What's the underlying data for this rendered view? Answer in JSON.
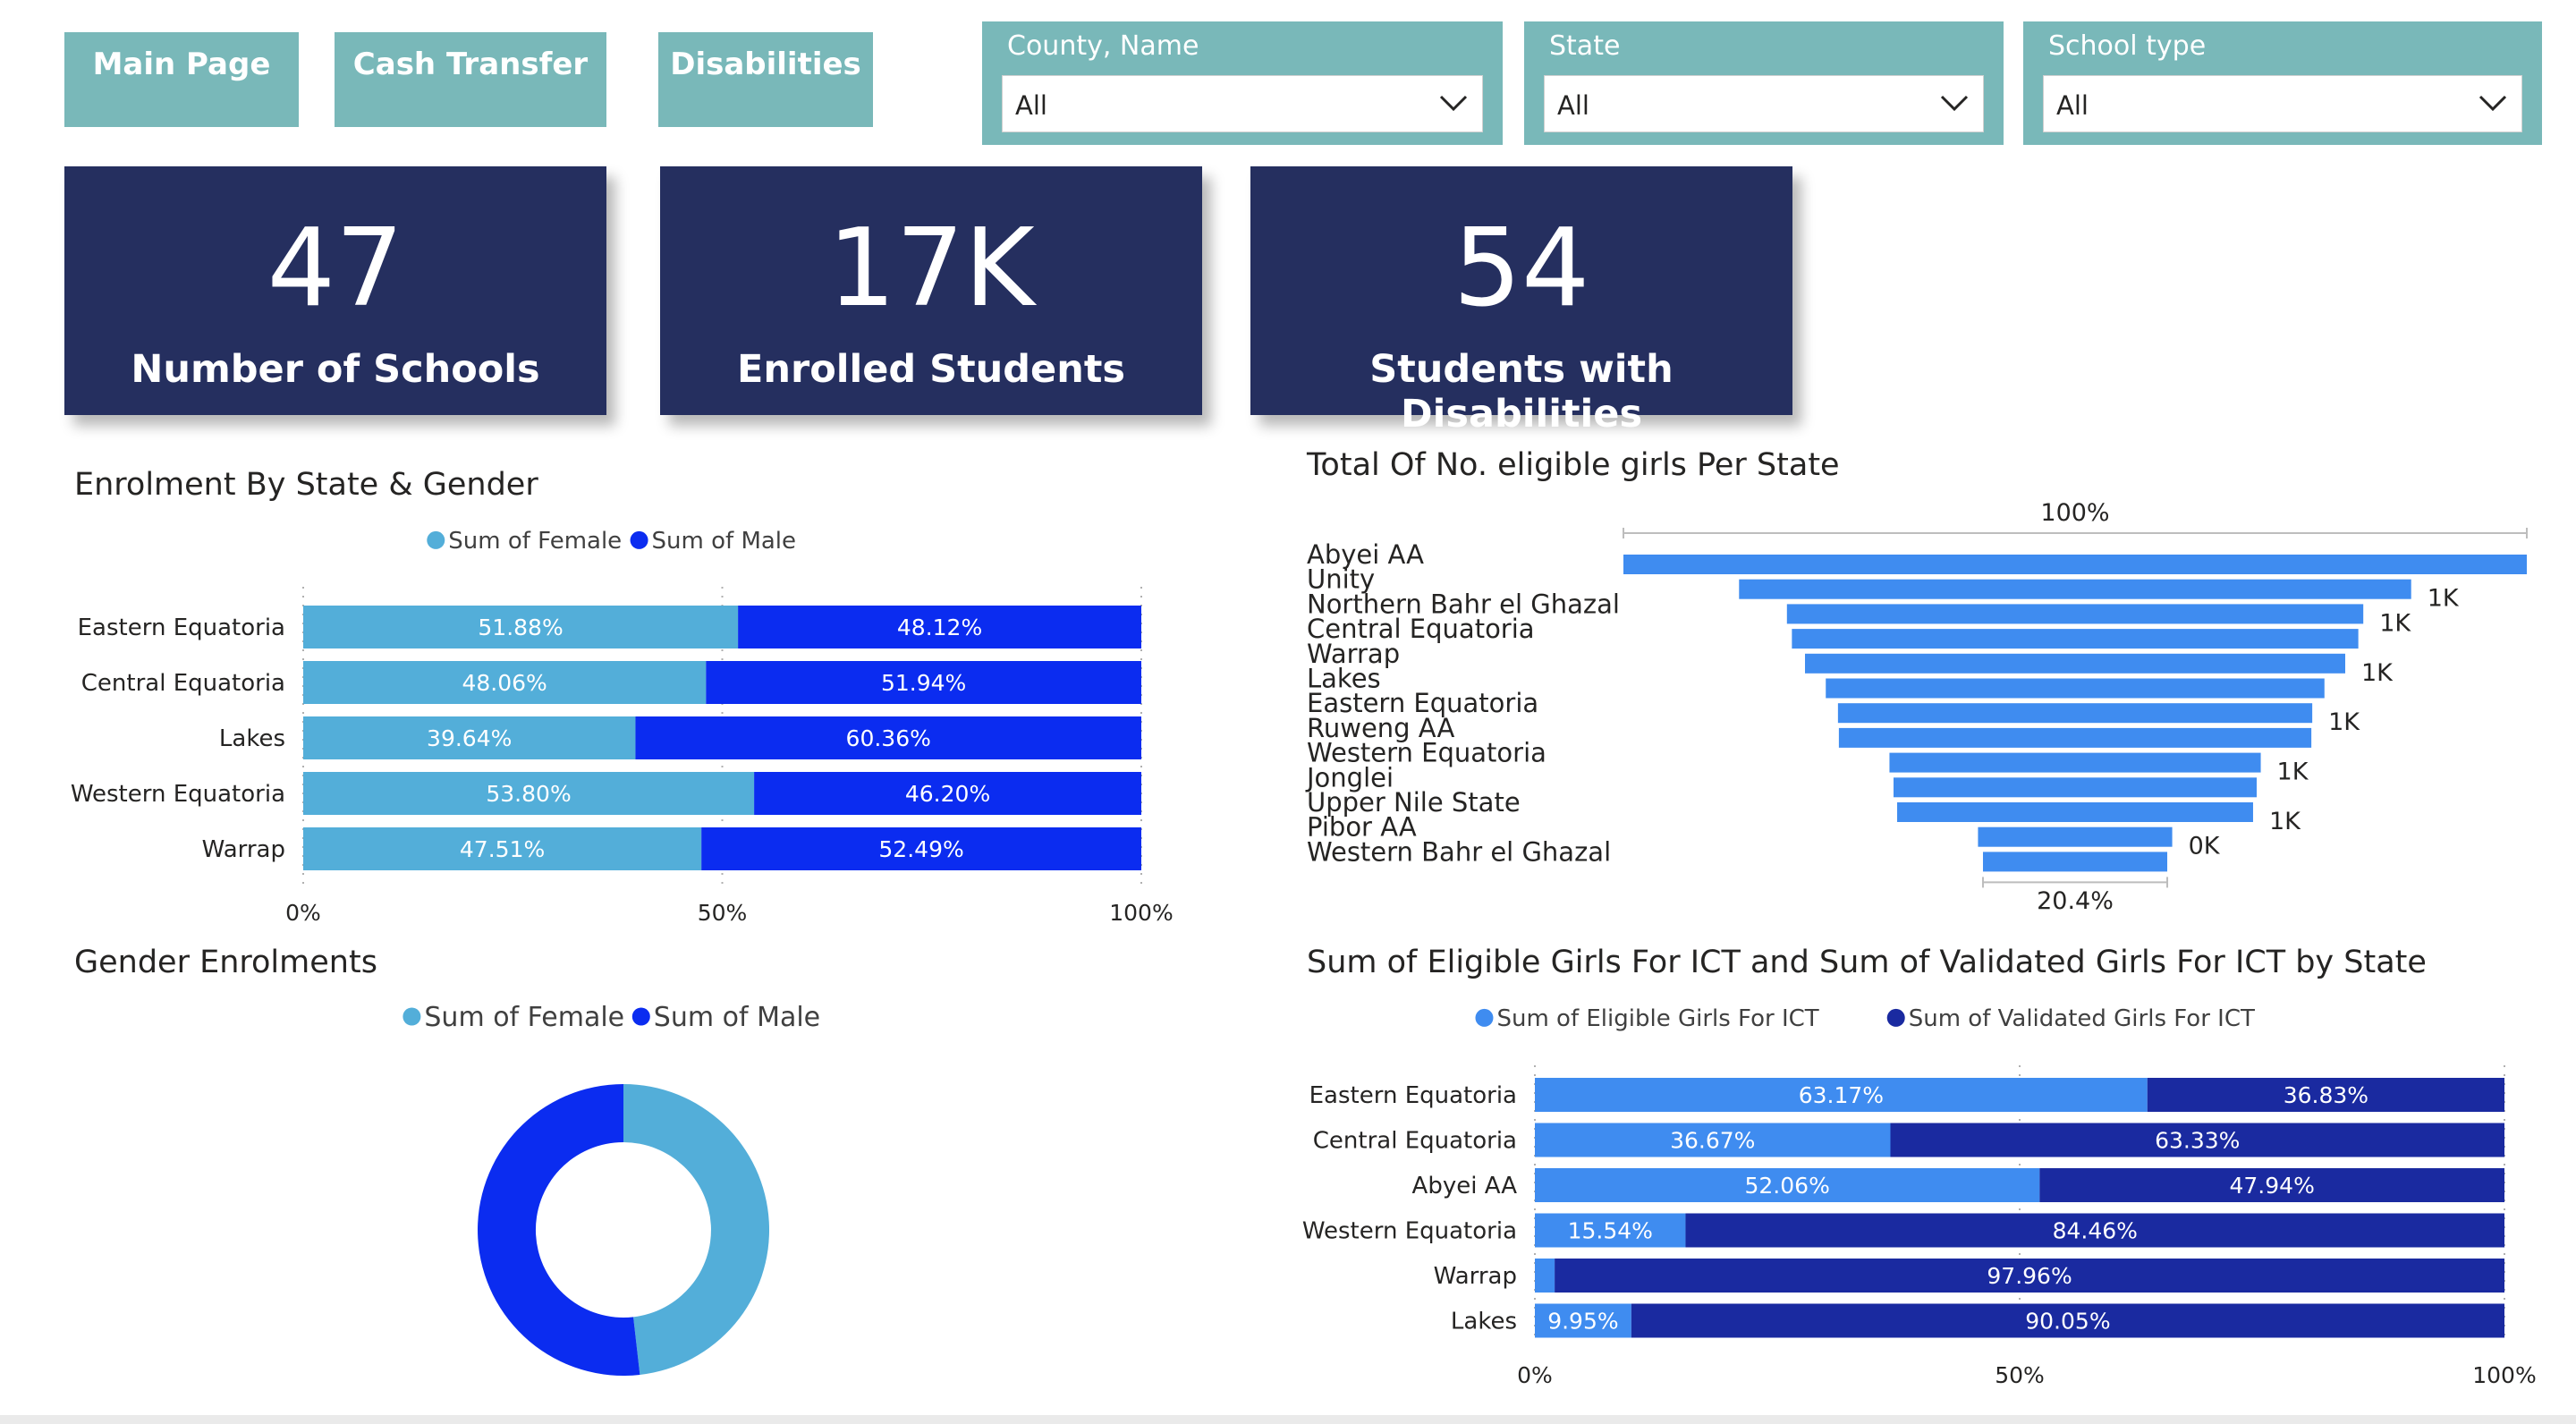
{
  "nav": {
    "main": "Main Page",
    "cash": "Cash Transfer",
    "disabilities": "Disabilities"
  },
  "slicers": {
    "county": {
      "title": "County, Name",
      "value": "All"
    },
    "state": {
      "title": "State",
      "value": "All"
    },
    "school": {
      "title": "School type",
      "value": "All"
    }
  },
  "kpis": [
    {
      "value": "47",
      "label": "Number of Schools"
    },
    {
      "value": "17K",
      "label": "Enrolled Students"
    },
    {
      "value": "54",
      "label": "Students with Disabilities"
    }
  ],
  "colors": {
    "female": "#53aed9",
    "male": "#0b2cf0",
    "funnel": "#3f8cf0",
    "eligible": "#3f8cf0",
    "validated": "#1a2aa0",
    "kpi_bg": "#252f5f",
    "nav_bg": "#79b8b9"
  },
  "chart_data": [
    {
      "type": "bar",
      "title": "Enrolment By State & Gender",
      "stacked": "100%",
      "orientation": "horizontal",
      "categories": [
        "Eastern Equatoria",
        "Central Equatoria",
        "Lakes",
        "Western Equatoria",
        "Warrap"
      ],
      "series": [
        {
          "name": "Sum of Female",
          "values": [
            51.88,
            48.06,
            39.64,
            53.8,
            47.51
          ],
          "labels": [
            "51.88%",
            "48.06%",
            "39.64%",
            "53.80%",
            "47.51%"
          ]
        },
        {
          "name": "Sum of Male",
          "values": [
            48.12,
            51.94,
            60.36,
            46.2,
            52.49
          ],
          "labels": [
            "48.12%",
            "51.94%",
            "60.36%",
            "46.20%",
            "52.49%"
          ]
        }
      ],
      "x_ticks": [
        "0%",
        "50%",
        "100%"
      ],
      "legend": "top"
    },
    {
      "type": "funnel",
      "title": "Total Of No. eligible girls Per State",
      "categories": [
        "Abyei AA",
        "Unity",
        "Northern Bahr el Ghazal",
        "Central Equatoria",
        "Warrap",
        "Lakes",
        "Eastern Equatoria",
        "Ruweng AA",
        "Western Equatoria",
        "Jonglei",
        "Upper Nile State",
        "Pibor AA",
        "Western Bahr el Ghazal"
      ],
      "values": [
        1.0,
        0.744,
        0.638,
        0.627,
        0.598,
        0.552,
        0.525,
        0.523,
        0.411,
        0.402,
        0.394,
        0.215,
        0.204
      ],
      "data_labels": [
        "",
        "1K",
        "1K",
        "",
        "1K",
        "",
        "1K",
        "",
        "1K",
        "",
        "1K",
        "0K",
        ""
      ],
      "top_label": "100%",
      "bottom_label": "20.4%"
    },
    {
      "type": "pie",
      "donut": true,
      "title": "Gender Enrolments",
      "series": [
        {
          "name": "Sum of Female",
          "value": 0.482
        },
        {
          "name": "Sum of Male",
          "value": 0.518
        }
      ],
      "legend": "top"
    },
    {
      "type": "bar",
      "title": "Sum of Eligible Girls For ICT and Sum of Validated Girls For ICT by State",
      "stacked": "100%",
      "orientation": "horizontal",
      "categories": [
        "Eastern Equatoria",
        "Central Equatoria",
        "Abyei AA",
        "Western Equatoria",
        "Warrap",
        "Lakes"
      ],
      "series": [
        {
          "name": "Sum of Eligible Girls For ICT",
          "values": [
            63.17,
            36.67,
            52.06,
            15.54,
            2.04,
            9.95
          ],
          "labels": [
            "63.17%",
            "36.67%",
            "52.06%",
            "15.54%",
            "",
            "9.95%"
          ]
        },
        {
          "name": "Sum of Validated Girls For ICT",
          "values": [
            36.83,
            63.33,
            47.94,
            84.46,
            97.96,
            90.05
          ],
          "labels": [
            "36.83%",
            "63.33%",
            "47.94%",
            "84.46%",
            "97.96%",
            "90.05%"
          ]
        }
      ],
      "x_ticks": [
        "0%",
        "50%",
        "100%"
      ],
      "legend": "top"
    }
  ]
}
